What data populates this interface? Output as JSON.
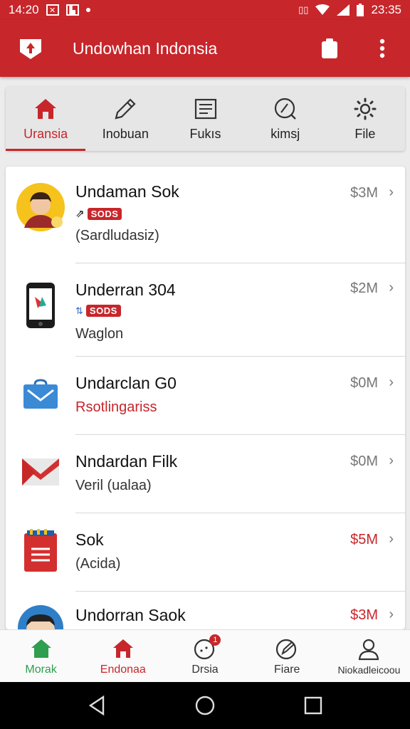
{
  "status_bar": {
    "time_left": "14:20",
    "time_right": "23:35"
  },
  "app_bar": {
    "title": "Undowhan Indonsia"
  },
  "tabs": [
    {
      "label": "Uransia",
      "icon": "home-icon",
      "active": true
    },
    {
      "label": "Inobuan",
      "icon": "pencil-icon",
      "active": false
    },
    {
      "label": "Fukıs",
      "icon": "document-icon",
      "active": false
    },
    {
      "label": "kimsj",
      "icon": "compass-icon",
      "active": false
    },
    {
      "label": "File",
      "icon": "gear-icon",
      "active": false
    }
  ],
  "list": [
    {
      "title": "Undaman Sok",
      "badge": "SODS",
      "subtitle": "(Sardludasiz)",
      "price": "$3M",
      "price_red": false
    },
    {
      "title": "Underran 304",
      "badge": "SODS",
      "subtitle": "Waglon",
      "price": "$2M",
      "price_red": false
    },
    {
      "title": "Undarclan G0",
      "subtitle": "Rsotlingariss",
      "price": "$0M",
      "price_red": false
    },
    {
      "title": "Nndardan Filk",
      "subtitle": "Veril (ualaa)",
      "price": "$0M",
      "price_red": false
    },
    {
      "title": "Sok",
      "subtitle": "(Acida)",
      "price": "$5M",
      "price_red": true
    },
    {
      "title": "Undorran Saok",
      "price": "$3M",
      "price_red": true
    }
  ],
  "bottom_nav": [
    {
      "label": "Morak",
      "icon": "home-icon",
      "color": "#2e9e4f"
    },
    {
      "label": "Endonaa",
      "icon": "home-icon",
      "color": "#c7262b"
    },
    {
      "label": "Drsia",
      "icon": "chat-icon",
      "badge": "1",
      "color": "#333333"
    },
    {
      "label": "Fiare",
      "icon": "edit-icon",
      "color": "#333333"
    },
    {
      "label": "Niokadleicoou",
      "icon": "person-icon",
      "color": "#333333"
    }
  ],
  "colors": {
    "brand": "#c7262b",
    "green": "#2e9e4f"
  }
}
